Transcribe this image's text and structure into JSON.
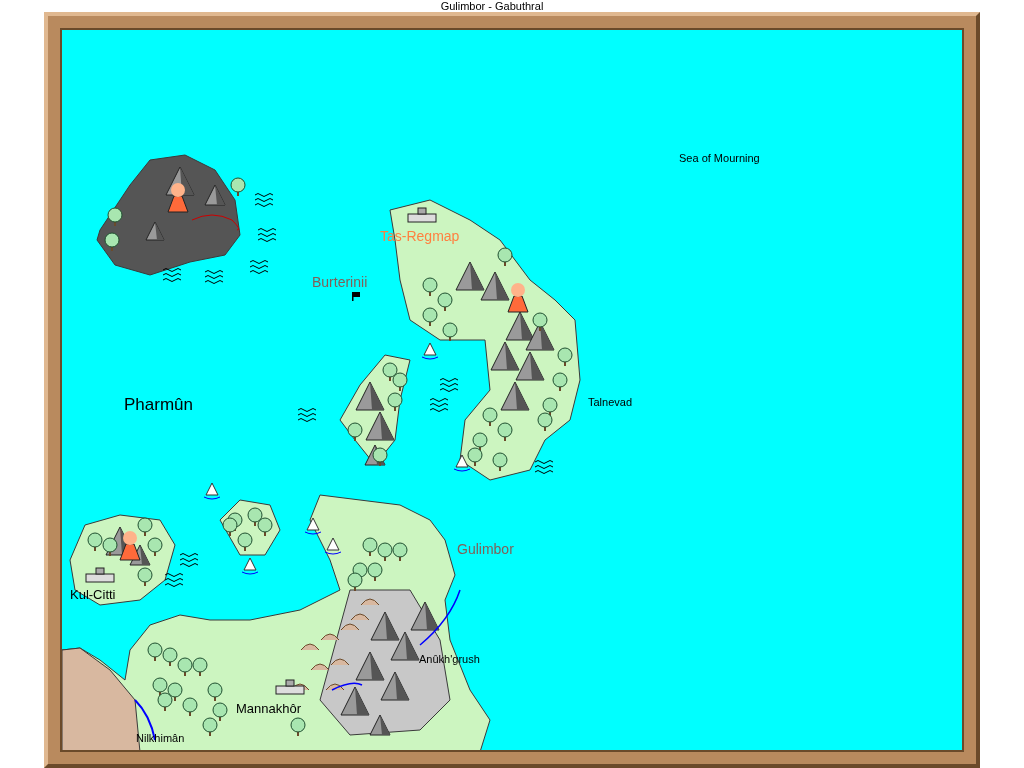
{
  "window": {
    "title": "Gulimbor - Gabuthral"
  },
  "map": {
    "labels": [
      {
        "text": "Sea of Mourning",
        "kind": "sea",
        "color": "#000000"
      },
      {
        "text": "Tas-Regmap",
        "kind": "landmark",
        "color": "#ff8040"
      },
      {
        "text": "Burterinii",
        "kind": "landmark",
        "color": "#806058"
      },
      {
        "text": "Pharmûn",
        "kind": "realm",
        "color": "#000000"
      },
      {
        "text": "Talnevad",
        "kind": "sea",
        "color": "#000000"
      },
      {
        "text": "Gulimbor",
        "kind": "landmark",
        "color": "#806058"
      },
      {
        "text": "Kul-Citti",
        "kind": "town",
        "color": "#000000"
      },
      {
        "text": "Anûkh'grush",
        "kind": "sea",
        "color": "#000000"
      },
      {
        "text": "Mannakhôr",
        "kind": "town",
        "color": "#000000"
      },
      {
        "text": "Nilkhimân",
        "kind": "sea",
        "color": "#000000"
      }
    ]
  }
}
